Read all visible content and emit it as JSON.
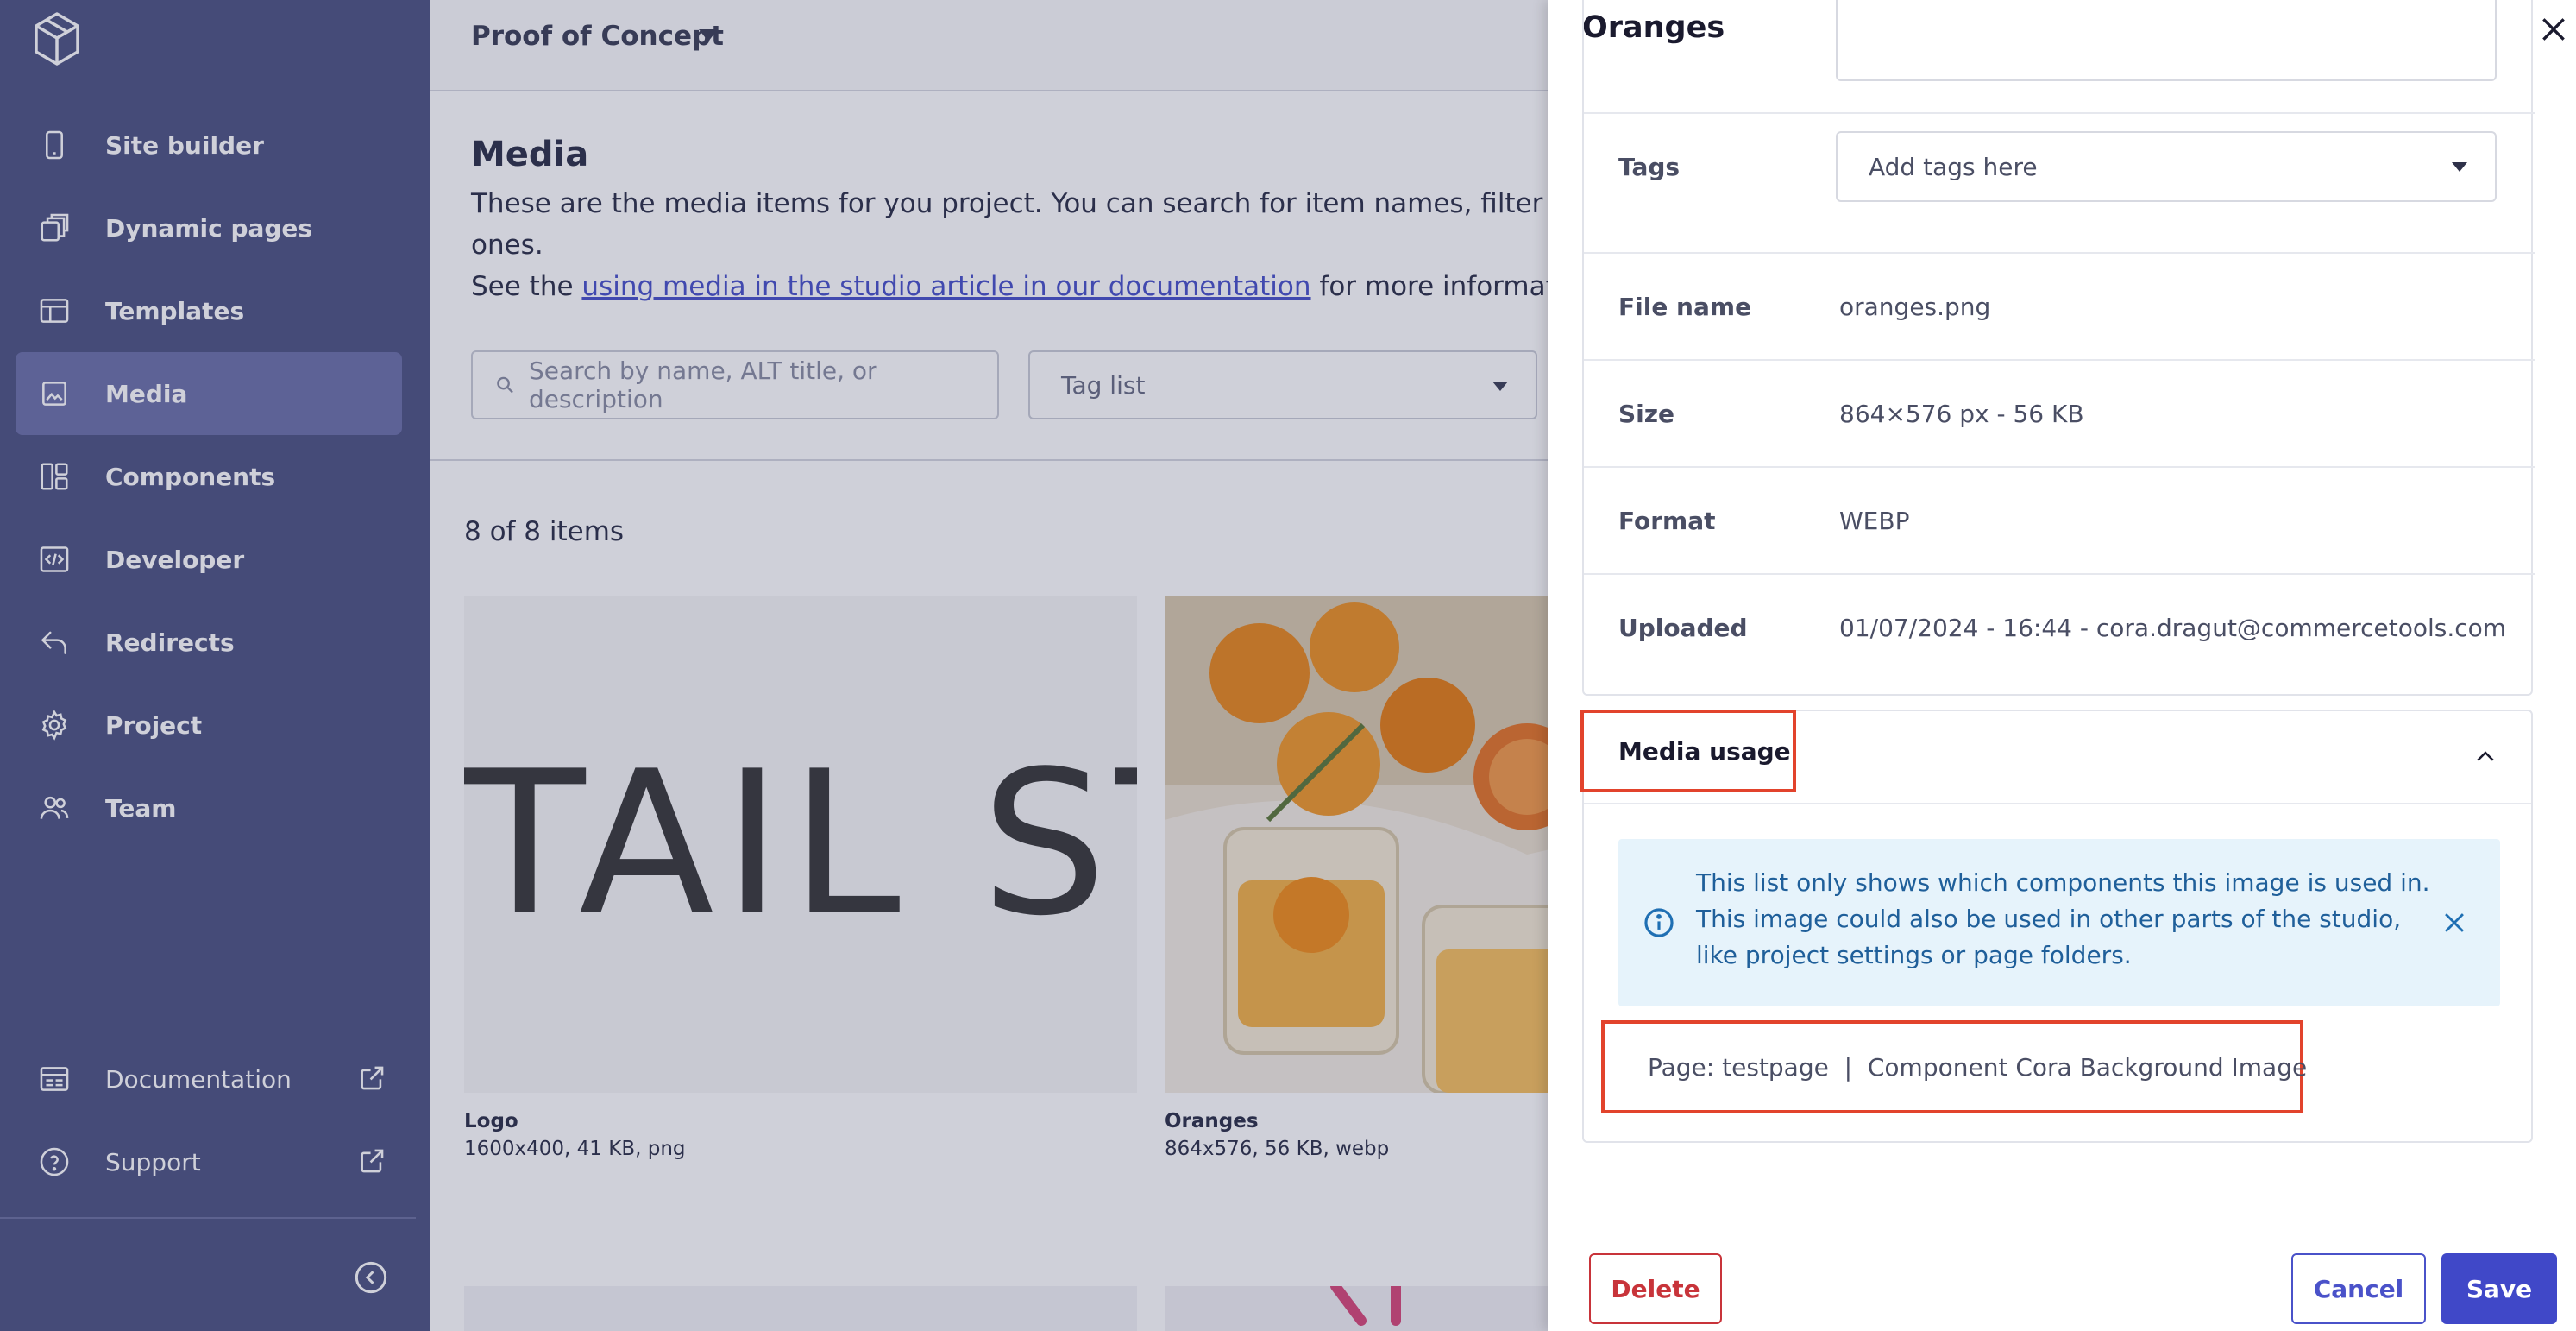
{
  "sidebar": {
    "items": [
      {
        "label": "Site builder",
        "icon": "mobile-icon"
      },
      {
        "label": "Dynamic pages",
        "icon": "stacked-pages-icon"
      },
      {
        "label": "Templates",
        "icon": "template-layout-icon"
      },
      {
        "label": "Media",
        "icon": "image-icon",
        "active": true
      },
      {
        "label": "Components",
        "icon": "components-icon"
      },
      {
        "label": "Developer",
        "icon": "code-icon"
      },
      {
        "label": "Redirects",
        "icon": "redirect-arrow-icon"
      },
      {
        "label": "Project",
        "icon": "gear-icon"
      },
      {
        "label": "Team",
        "icon": "team-icon"
      }
    ],
    "bottom": [
      {
        "label": "Documentation",
        "icon": "documentation-icon"
      },
      {
        "label": "Support",
        "icon": "help-circle-icon"
      }
    ]
  },
  "header": {
    "project_name": "Proof of Concept"
  },
  "main": {
    "title": "Media",
    "description_line1": "These are the media items for you project. You can search for item names, filter by tag, e",
    "description_line2": "ones.",
    "description_see": "See the",
    "description_link": "using media in the studio article in our documentation",
    "description_more": "for more information.",
    "search_placeholder": "Search by name, ALT title, or description",
    "tag_list_placeholder": "Tag list",
    "item_count": "8 of 8 items",
    "cards": [
      {
        "name": "Logo",
        "meta": "1600x400, 41 KB, png",
        "thumb_text": "TAIL ST"
      },
      {
        "name": "Oranges",
        "meta": "864x576, 56 KB, webp"
      }
    ]
  },
  "drawer": {
    "title": "Oranges",
    "fields": {
      "tags_label": "Tags",
      "tags_placeholder": "Add tags here",
      "file_name_label": "File name",
      "file_name_value": "oranges.png",
      "size_label": "Size",
      "size_value": "864×576 px - 56 KB",
      "format_label": "Format",
      "format_value": "WEBP",
      "uploaded_label": "Uploaded",
      "uploaded_value": "01/07/2024 - 16:44 - cora.dragut@commercetools.com"
    },
    "usage": {
      "title": "Media usage",
      "info_text": "This list only shows which components this image is used in. This image could also be used in other parts of the studio, like project settings or page folders.",
      "item": "Page: testpage  |  Component Cora Background Image"
    },
    "footer": {
      "delete_label": "Delete",
      "cancel_label": "Cancel",
      "save_label": "Save"
    }
  },
  "colors": {
    "sidebar_bg": "#4f5583",
    "sidebar_active": "#6e72a9",
    "primary": "#4048c8",
    "danger": "#c8343a",
    "highlight": "#e2432c",
    "info_bg": "#e6f3fb"
  }
}
